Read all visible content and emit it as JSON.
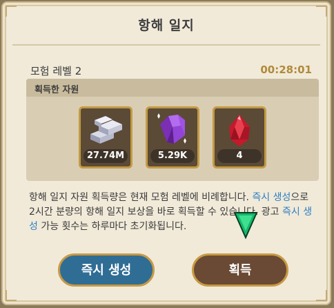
{
  "title": "항해 일지",
  "adventure": {
    "level_label": "모험 레벨 2",
    "timer": "00:28:01"
  },
  "resources": {
    "header": "획득한 자원",
    "items": [
      {
        "icon": "silver-ingots-icon",
        "count": "27.74M"
      },
      {
        "icon": "purple-crystal-icon",
        "count": "5.29K"
      },
      {
        "icon": "red-gem-icon",
        "count": "4"
      }
    ]
  },
  "description": {
    "part1": "항해 일지 자원 획득량은 현재 모험 레벨에 비례합니다. ",
    "link1": "즉시 생성",
    "part2": "으로 2시간 분량의 항해 일지 보상을 바로 획득할 수 있습니다. 광고 ",
    "link2": "즉시 생성",
    "part3": " 가능 횟수는 하루마다 초기화됩니다."
  },
  "buttons": {
    "instant": "즉시 생성",
    "get": "획득"
  },
  "colors": {
    "accent_blue": "#2d7fc4",
    "timer": "#b08a3a",
    "frame_gold": "#c49a44"
  }
}
